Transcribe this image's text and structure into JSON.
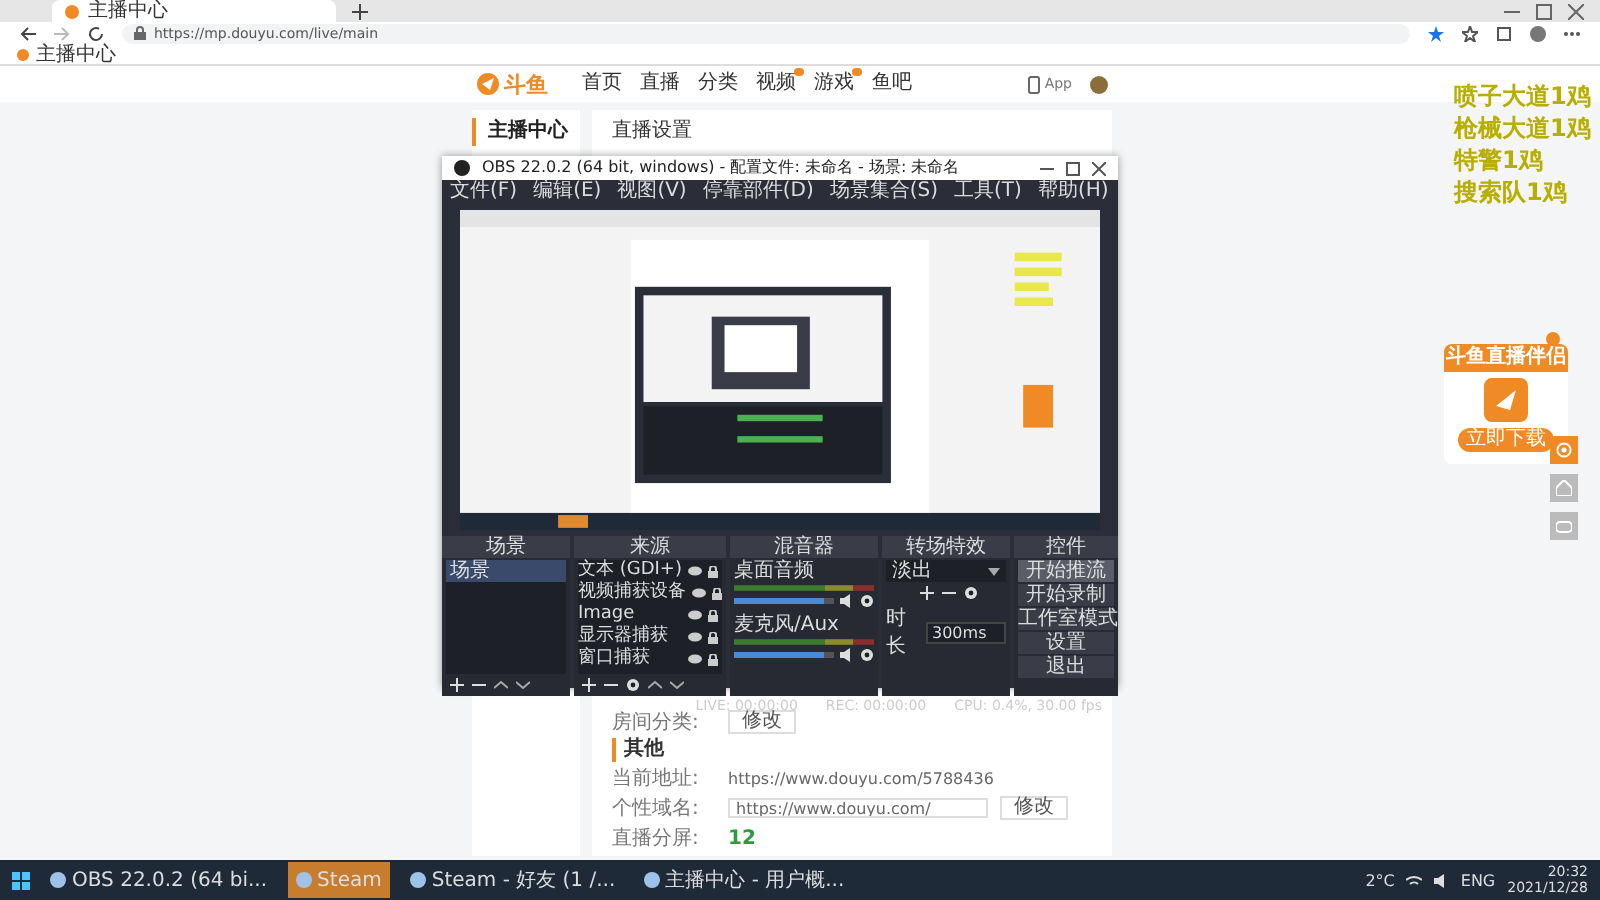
{
  "browser": {
    "tabs": [
      {
        "title": "主播中心",
        "selected": true
      }
    ],
    "url": "https://mp.douyu.com/live/main",
    "bookmarks": [
      "主播中心"
    ]
  },
  "site_header": {
    "logo": "斗鱼",
    "nav": [
      {
        "label": "首页",
        "badge": false
      },
      {
        "label": "直播",
        "badge": false
      },
      {
        "label": "分类",
        "badge": false
      },
      {
        "label": "视频",
        "badge": true
      },
      {
        "label": "游戏",
        "badge": true
      },
      {
        "label": "鱼吧",
        "badge": false
      }
    ],
    "app_link": "App"
  },
  "sidebar": {
    "items": [
      {
        "label": "主播中心",
        "selected": true
      }
    ]
  },
  "settings": {
    "title": "直播设置",
    "room_category": {
      "label": "房间分类:",
      "button": "修改"
    },
    "other_heading": "其他",
    "rows": [
      {
        "kind": "text",
        "label": "当前地址:",
        "value": "https://www.douyu.com/5788436"
      },
      {
        "kind": "input",
        "label": "个性域名:",
        "value": "https://www.douyu.com/",
        "button": "修改"
      },
      {
        "kind": "count",
        "label": "直播分屏:",
        "value": "12"
      }
    ]
  },
  "overlay_text": [
    "喷子大道1鸡",
    "枪械大道1鸡",
    "特警1鸡",
    "搜索队1鸡"
  ],
  "promo": {
    "title": "斗鱼直播伴侣",
    "button": "立即下载"
  },
  "obs": {
    "title": "OBS 22.0.2 (64 bit, windows) - 配置文件: 未命名 - 场景: 未命名",
    "menu": [
      "文件(F)",
      "编辑(E)",
      "视图(V)",
      "停靠部件(D)",
      "场景集合(S)",
      "工具(T)",
      "帮助(H)"
    ],
    "scenes": {
      "title": "场景",
      "items": [
        {
          "label": "场景",
          "selected": true
        }
      ]
    },
    "sources": {
      "title": "来源",
      "items": [
        "文本 (GDI+)",
        "视频捕获设备",
        "Image",
        "显示器捕获",
        "窗口捕获"
      ]
    },
    "mixer": {
      "title": "混音器",
      "channels": [
        {
          "name": "桌面音频",
          "level": 0.9
        },
        {
          "name": "麦克风/Aux",
          "level": 0.9
        }
      ]
    },
    "transitions": {
      "title": "转场特效",
      "selected": "淡出",
      "duration_label": "时长",
      "duration": "300ms"
    },
    "controls": {
      "title": "控件",
      "buttons": [
        {
          "label": "开始推流",
          "selected": true
        },
        {
          "label": "开始录制",
          "selected": false
        },
        {
          "label": "工作室模式",
          "selected": false
        },
        {
          "label": "设置",
          "selected": false
        },
        {
          "label": "退出",
          "selected": false
        }
      ]
    },
    "status": [
      "LIVE: 00:00:00",
      "REC: 00:00:00",
      "CPU: 0.4%, 30.00 fps"
    ]
  },
  "taskbar": {
    "items": [
      {
        "label": "OBS 22.0.2 (64 bi...",
        "selected": false
      },
      {
        "label": "Steam",
        "selected": true
      },
      {
        "label": "Steam - 好友 (1 /...",
        "selected": false
      },
      {
        "label": "主播中心 - 用户概...",
        "selected": false
      }
    ],
    "weather": "2°C",
    "language": "ENG",
    "time": "20:32",
    "date": "2021/12/28"
  }
}
